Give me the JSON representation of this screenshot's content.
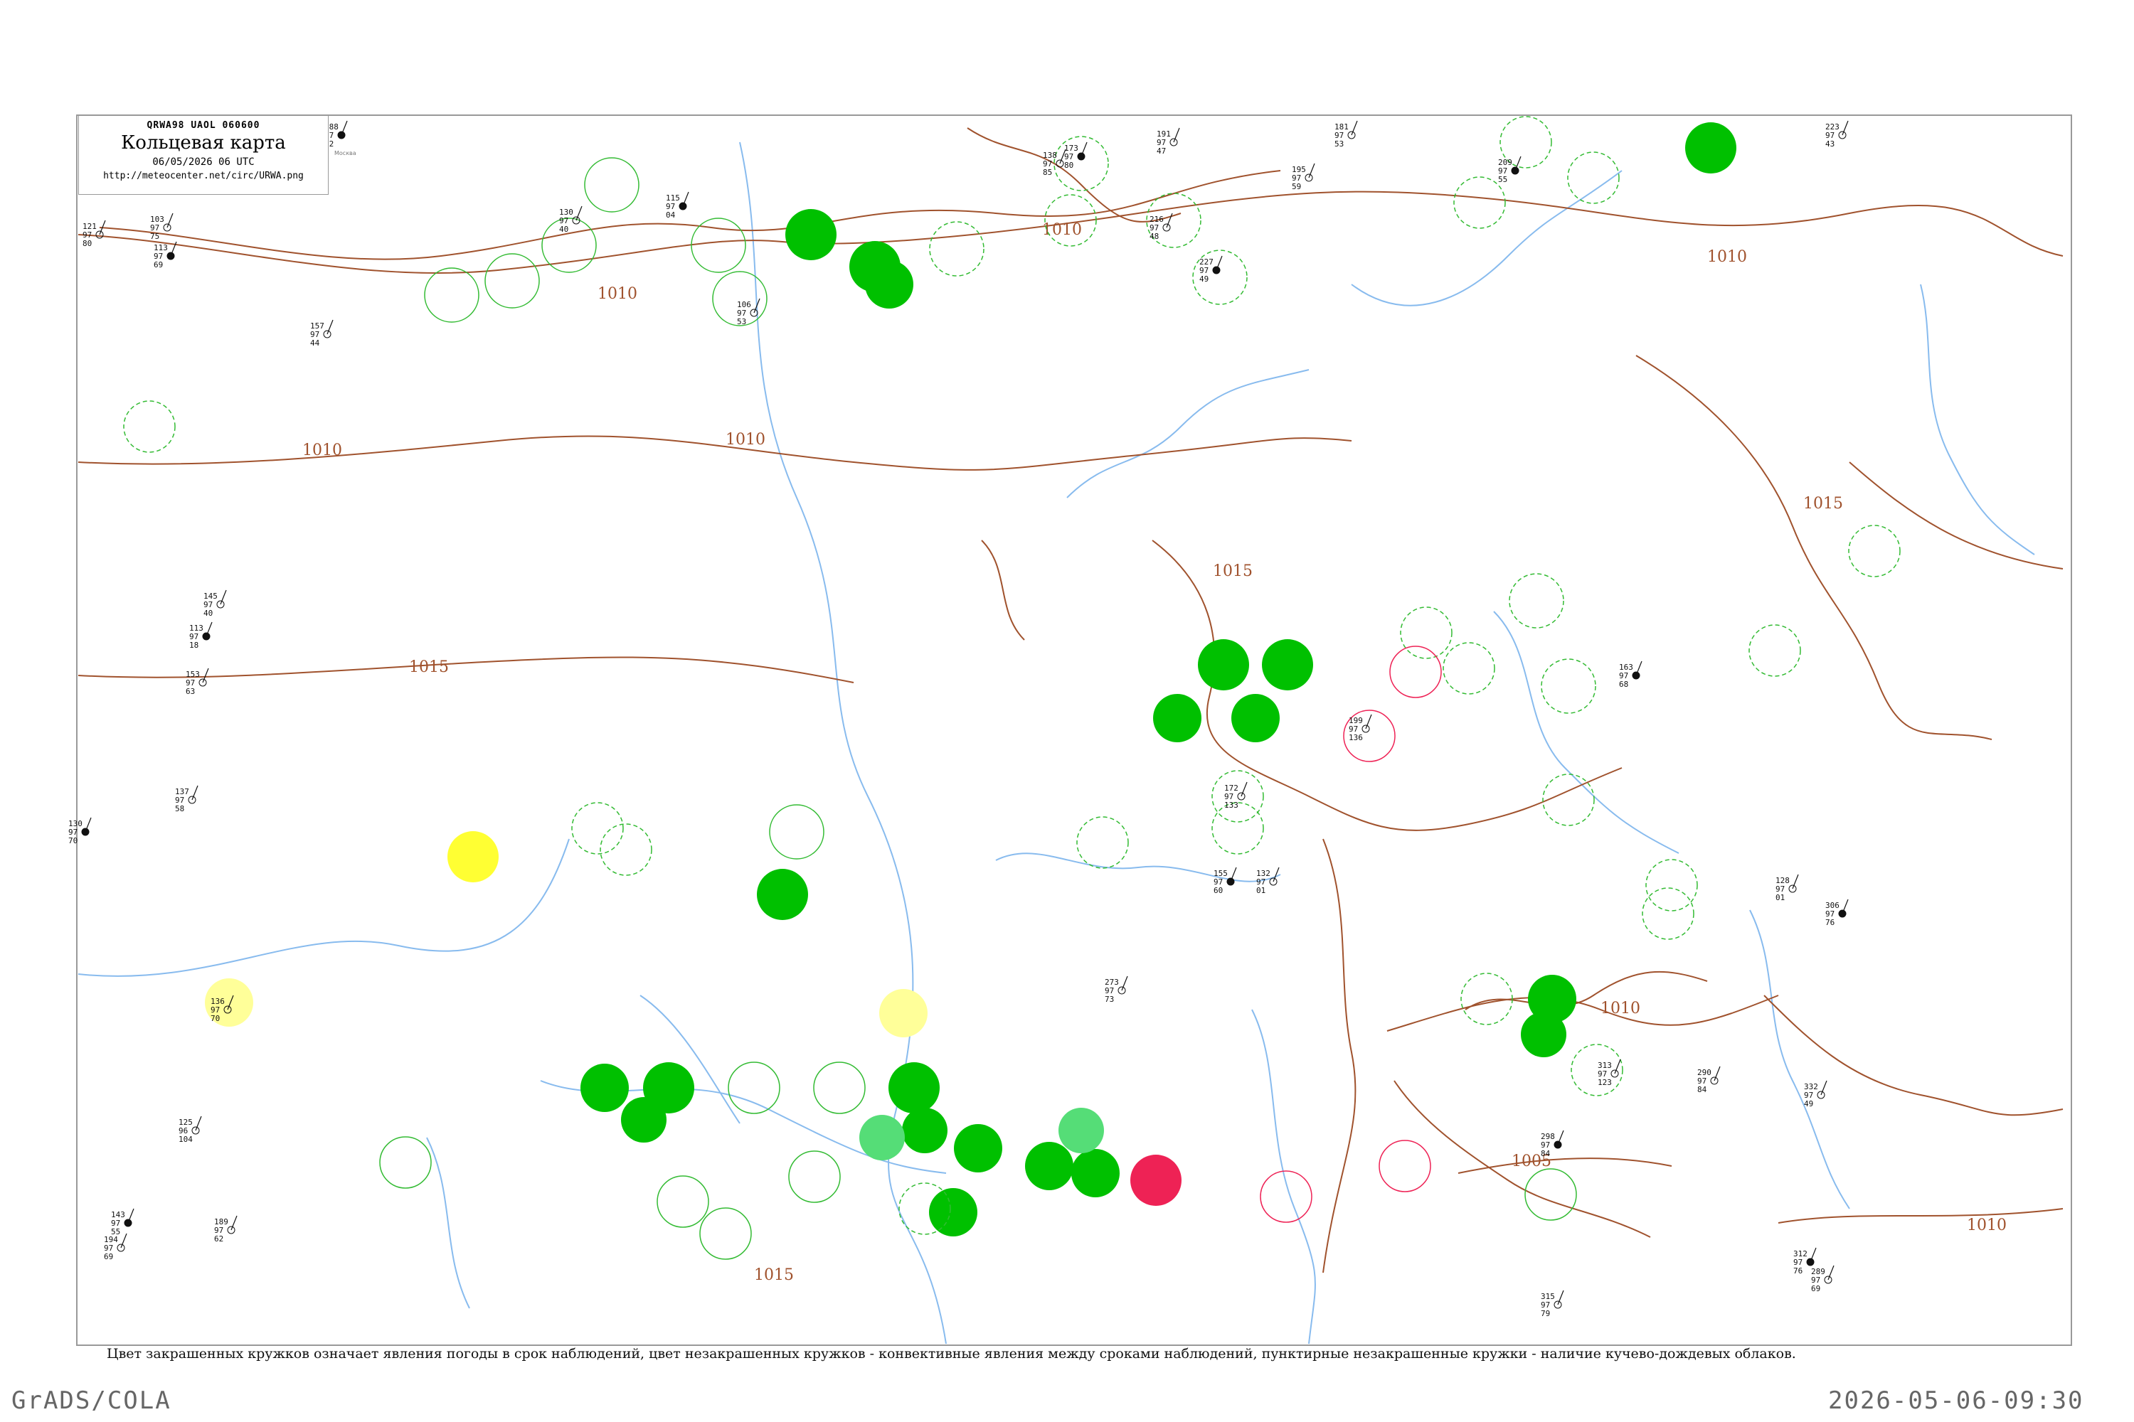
{
  "header": {
    "code": "QRWA98  UAOL  060600",
    "title": "Кольцевая карта",
    "datetime": "06/05/2026 06 UTC",
    "url": "http://meteocenter.net/circ/URWA.png"
  },
  "caption": "Цвет закрашенных кружков означает явления погоды в срок наблюдений, цвет незакрашенных кружков - конвективные явления между сроками наблюдений, пунктирные незакрашенные кружки - наличие кучево-дождевых облаков.",
  "footer": {
    "left": "GrADS/COLA",
    "right": "2026-05-06-09:30"
  },
  "colors": {
    "green": "#00c000",
    "light_green": "#55dd77",
    "yellow": "#ffff33",
    "pale_yellow": "#ffff99",
    "red": "#ee2255",
    "isobar": "#a0522d",
    "river": "#88bbee"
  },
  "isobar_labels": [
    "1010",
    "1010",
    "1010",
    "1010",
    "1010",
    "1015",
    "1015",
    "1015",
    "1010",
    "1005",
    "1010",
    "1015"
  ],
  "stations": [
    {
      "p": "088",
      "t": "97",
      "d": "52",
      "name": "Москва"
    },
    {
      "p": "121",
      "t": "97",
      "d": "80"
    },
    {
      "p": "103",
      "t": "97",
      "d": "75"
    },
    {
      "p": "113",
      "t": "97",
      "d": "69"
    },
    {
      "p": "157",
      "t": "97",
      "d": "44"
    },
    {
      "p": "130",
      "t": "97",
      "d": "40"
    },
    {
      "p": "115",
      "t": "97",
      "d": "04"
    },
    {
      "p": "106",
      "t": "97",
      "d": "53"
    },
    {
      "p": "138",
      "t": "97",
      "d": "85"
    },
    {
      "p": "173",
      "t": "97",
      "d": "80"
    },
    {
      "p": "191",
      "t": "97",
      "d": "47"
    },
    {
      "p": "216",
      "t": "97",
      "d": "48"
    },
    {
      "p": "227",
      "t": "97",
      "d": "49"
    },
    {
      "p": "195",
      "t": "97",
      "d": "59"
    },
    {
      "p": "181",
      "t": "97",
      "d": "53"
    },
    {
      "p": "209",
      "t": "97",
      "d": "55"
    },
    {
      "p": "223",
      "t": "97",
      "d": "43"
    },
    {
      "p": "145",
      "t": "97",
      "d": "40"
    },
    {
      "p": "113",
      "t": "97",
      "d": "18"
    },
    {
      "p": "153",
      "t": "97",
      "d": "63"
    },
    {
      "p": "137",
      "t": "97",
      "d": "58"
    },
    {
      "p": "130",
      "t": "97",
      "d": "70"
    },
    {
      "p": "136",
      "t": "97",
      "d": "70"
    },
    {
      "p": "125",
      "t": "96",
      "d": "104"
    },
    {
      "p": "143",
      "t": "97",
      "d": "55"
    },
    {
      "p": "194",
      "t": "97",
      "d": "69"
    },
    {
      "p": "189",
      "t": "97",
      "d": "62"
    },
    {
      "p": "163",
      "t": "97",
      "d": "68"
    },
    {
      "p": "199",
      "t": "97",
      "d": "136"
    },
    {
      "p": "172",
      "t": "97",
      "d": "133"
    },
    {
      "p": "155",
      "t": "97",
      "d": "60"
    },
    {
      "p": "132",
      "t": "97",
      "d": "01"
    },
    {
      "p": "128",
      "t": "97",
      "d": "01"
    },
    {
      "p": "306",
      "t": "97",
      "d": "76"
    },
    {
      "p": "313",
      "t": "97",
      "d": "123"
    },
    {
      "p": "290",
      "t": "97",
      "d": "84"
    },
    {
      "p": "298",
      "t": "97",
      "d": "84"
    },
    {
      "p": "289",
      "t": "97",
      "d": "69"
    },
    {
      "p": "332",
      "t": "97",
      "d": "49"
    },
    {
      "p": "312",
      "t": "97",
      "d": "76"
    },
    {
      "p": "315",
      "t": "97",
      "d": "79"
    },
    {
      "p": "273",
      "t": "97",
      "d": "73"
    }
  ]
}
